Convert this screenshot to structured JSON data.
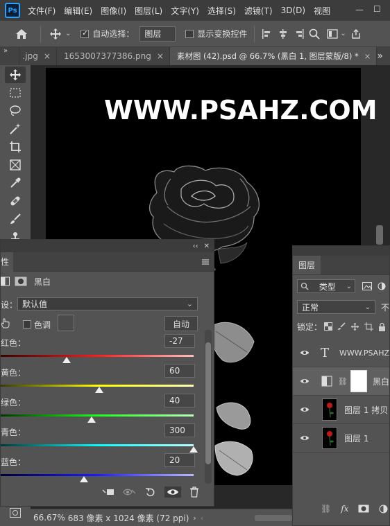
{
  "menubar": {
    "items": [
      "文件(F)",
      "编辑(E)",
      "图像(I)",
      "图层(L)",
      "文字(Y)",
      "选择(S)",
      "滤镜(T)",
      "3D(D)",
      "视图"
    ],
    "window_controls": [
      "—",
      "☐"
    ]
  },
  "options": {
    "auto_select_label": "自动选择：",
    "auto_select_checked": "✓",
    "auto_select_value": "图层",
    "show_transform_label": "显示变换控件"
  },
  "tabs": [
    {
      "label": ".jpg",
      "close": "×"
    },
    {
      "label": "1653007377386.png",
      "close": "×"
    },
    {
      "label": "素材图 (42).psd @ 66.7% (黑白 1, 图层蒙版/8) *",
      "close": "×"
    }
  ],
  "tab_overflow": "»",
  "tab_more": "»",
  "canvas": {
    "watermark": "WWW.PSAHZ.COM"
  },
  "properties": {
    "panel_name": "性",
    "collapse_glyph": "‹‹",
    "close_glyph": "✕",
    "adjustment_name": "黑白",
    "preset_label": "设：",
    "preset_value": "默认值",
    "tint_label": "色调",
    "auto_button": "自动",
    "sliders": [
      {
        "label": "红色：",
        "value": "-27",
        "fraction": 0.34,
        "gradient": [
          "#3a0000",
          "#ff1a1a",
          "#ffbdbd"
        ]
      },
      {
        "label": "黄色：",
        "value": "60",
        "fraction": 0.51,
        "gradient": [
          "#3a3a00",
          "#ffff00",
          "#ffffb8"
        ]
      },
      {
        "label": "绿色：",
        "value": "40",
        "fraction": 0.47,
        "gradient": [
          "#003a00",
          "#1aff1a",
          "#b8ffb8"
        ]
      },
      {
        "label": "青色：",
        "value": "300",
        "fraction": 1.0,
        "gradient": [
          "#003a3a",
          "#00ffff",
          "#b8ffff"
        ]
      },
      {
        "label": "蓝色：",
        "value": "20",
        "fraction": 0.43,
        "gradient": [
          "#00003a",
          "#1a1aff",
          "#b8b8ff"
        ]
      }
    ]
  },
  "layers": {
    "panel_title": "图层",
    "kind_filter": "类型",
    "blend_mode": "正常",
    "opacity_label": "不",
    "lock_label": "锁定：",
    "items": [
      {
        "name": "WWW.PSAHZ",
        "type": "text",
        "thumb": "T"
      },
      {
        "name": "黑白",
        "type": "adjustment"
      },
      {
        "name": "图层 1 拷贝",
        "type": "image"
      },
      {
        "name": "图层 1",
        "type": "image"
      }
    ]
  },
  "status": {
    "zoom": "66.67%",
    "doc_size": "683 像素 x 1024 像素 (72 ppi)"
  },
  "colors": {
    "accent": "#2fa3f7",
    "panel_bg": "#535353",
    "dark_bg": "#282828"
  }
}
